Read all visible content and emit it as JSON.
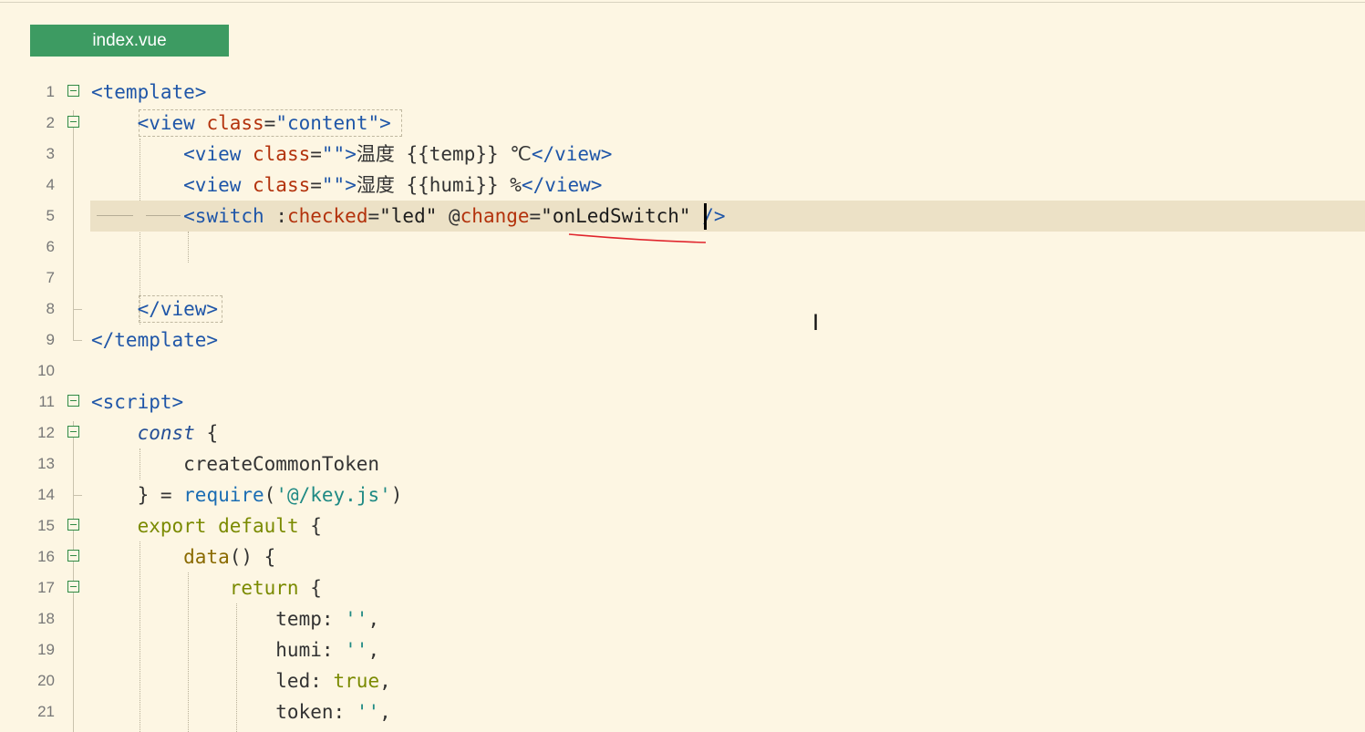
{
  "tab": {
    "label": "index.vue"
  },
  "editor": {
    "lines": [
      {
        "num": "1",
        "segs": [
          {
            "text": "<template>",
            "c": "t"
          }
        ]
      },
      {
        "num": "2",
        "segs": [
          {
            "text": "    ",
            "c": "p"
          },
          {
            "text": "<view ",
            "c": "t"
          },
          {
            "text": "class",
            "c": "a"
          },
          {
            "text": "=",
            "c": "p"
          },
          {
            "text": "\"content\"",
            "c": "t"
          },
          {
            "text": ">",
            "c": "t"
          }
        ]
      },
      {
        "num": "3",
        "segs": [
          {
            "text": "        ",
            "c": "p"
          },
          {
            "text": "<view ",
            "c": "t"
          },
          {
            "text": "class",
            "c": "a"
          },
          {
            "text": "=",
            "c": "p"
          },
          {
            "text": "\"\"",
            "c": "t"
          },
          {
            "text": ">",
            "c": "t"
          },
          {
            "text": "温度 {{temp}} ℃",
            "c": "p"
          },
          {
            "text": "</view>",
            "c": "t"
          }
        ]
      },
      {
        "num": "4",
        "segs": [
          {
            "text": "        ",
            "c": "p"
          },
          {
            "text": "<view ",
            "c": "t"
          },
          {
            "text": "class",
            "c": "a"
          },
          {
            "text": "=",
            "c": "p"
          },
          {
            "text": "\"\"",
            "c": "t"
          },
          {
            "text": ">",
            "c": "t"
          },
          {
            "text": "湿度 {{humi}} %",
            "c": "p"
          },
          {
            "text": "</view>",
            "c": "t"
          }
        ]
      },
      {
        "num": "5",
        "current": true,
        "segs": [
          {
            "text": "        ",
            "c": "p"
          },
          {
            "text": "<switch ",
            "c": "t"
          },
          {
            "text": ":",
            "c": "p"
          },
          {
            "text": "checked",
            "c": "a"
          },
          {
            "text": "=",
            "c": "p"
          },
          {
            "text": "\"led\" ",
            "c": "s"
          },
          {
            "text": "@",
            "c": "p"
          },
          {
            "text": "change",
            "c": "a"
          },
          {
            "text": "=",
            "c": "p"
          },
          {
            "text": "\"onLedSwitch\" ",
            "c": "s"
          },
          {
            "text": "/>",
            "c": "t"
          }
        ]
      },
      {
        "num": "6",
        "segs": []
      },
      {
        "num": "7",
        "segs": []
      },
      {
        "num": "8",
        "segs": [
          {
            "text": "    ",
            "c": "p"
          },
          {
            "text": "</view>",
            "c": "t"
          }
        ]
      },
      {
        "num": "9",
        "segs": [
          {
            "text": "</template>",
            "c": "t"
          }
        ]
      },
      {
        "num": "10",
        "segs": []
      },
      {
        "num": "11",
        "segs": [
          {
            "text": "<script>",
            "c": "t"
          }
        ]
      },
      {
        "num": "12",
        "segs": [
          {
            "text": "    ",
            "c": "p"
          },
          {
            "text": "const",
            "c": "kwi"
          },
          {
            "text": " {",
            "c": "p"
          }
        ]
      },
      {
        "num": "13",
        "segs": [
          {
            "text": "        createCommonToken",
            "c": "p"
          }
        ]
      },
      {
        "num": "14",
        "segs": [
          {
            "text": "    } = ",
            "c": "p"
          },
          {
            "text": "require",
            "c": "bl"
          },
          {
            "text": "(",
            "c": "p"
          },
          {
            "text": "'@/key.js'",
            "c": "str"
          },
          {
            "text": ")",
            "c": "p"
          }
        ]
      },
      {
        "num": "15",
        "segs": [
          {
            "text": "    ",
            "c": "p"
          },
          {
            "text": "export default",
            "c": "kw"
          },
          {
            "text": " {",
            "c": "p"
          }
        ]
      },
      {
        "num": "16",
        "segs": [
          {
            "text": "        ",
            "c": "p"
          },
          {
            "text": "data",
            "c": "fn"
          },
          {
            "text": "() {",
            "c": "p"
          }
        ]
      },
      {
        "num": "17",
        "segs": [
          {
            "text": "            ",
            "c": "p"
          },
          {
            "text": "return",
            "c": "kw"
          },
          {
            "text": " {",
            "c": "p"
          }
        ]
      },
      {
        "num": "18",
        "segs": [
          {
            "text": "                temp: ",
            "c": "p"
          },
          {
            "text": "''",
            "c": "str"
          },
          {
            "text": ",",
            "c": "p"
          }
        ]
      },
      {
        "num": "19",
        "segs": [
          {
            "text": "                humi: ",
            "c": "p"
          },
          {
            "text": "''",
            "c": "str"
          },
          {
            "text": ",",
            "c": "p"
          }
        ]
      },
      {
        "num": "20",
        "segs": [
          {
            "text": "                led: ",
            "c": "p"
          },
          {
            "text": "true",
            "c": "kw"
          },
          {
            "text": ",",
            "c": "p"
          }
        ]
      },
      {
        "num": "21",
        "segs": [
          {
            "text": "                token: ",
            "c": "p"
          },
          {
            "text": "''",
            "c": "str"
          },
          {
            "text": ",",
            "c": "p"
          }
        ]
      }
    ],
    "fold_lines": [
      "1",
      "2",
      "11",
      "12",
      "15",
      "16",
      "17"
    ]
  }
}
